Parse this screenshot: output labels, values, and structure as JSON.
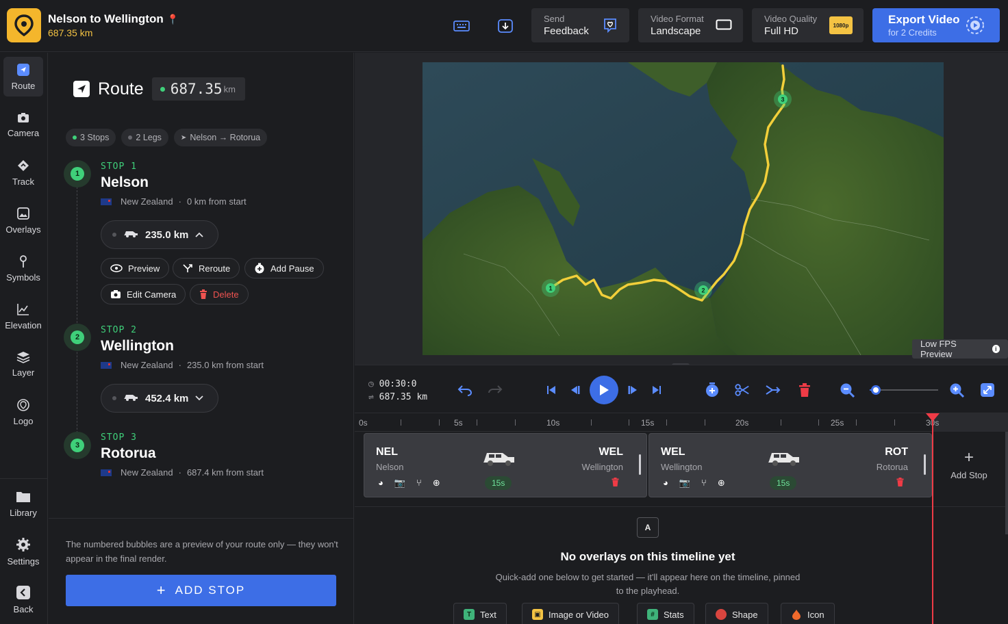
{
  "app": {
    "title": "Nelson to Wellington",
    "distance": "687.35 km"
  },
  "toolbar": {
    "feedback": {
      "line1": "Send",
      "line2": "Feedback"
    },
    "format": {
      "line1": "Video Format",
      "line2": "Landscape"
    },
    "quality": {
      "line1": "Video Quality",
      "line2": "Full HD",
      "badge": "1080p"
    },
    "export": {
      "line1": "Export Video",
      "line2": "for 2 Credits"
    }
  },
  "nav": {
    "items": [
      {
        "label": "Route"
      },
      {
        "label": "Camera"
      },
      {
        "label": "Track"
      },
      {
        "label": "Overlays"
      },
      {
        "label": "Symbols"
      },
      {
        "label": "Elevation"
      },
      {
        "label": "Layer"
      },
      {
        "label": "Logo"
      }
    ],
    "bottom": [
      {
        "label": "Library"
      },
      {
        "label": "Settings"
      },
      {
        "label": "Back"
      }
    ]
  },
  "route": {
    "title": "Route",
    "km_value": "687.35",
    "km_unit": "km",
    "chips": {
      "stops": "3 Stops",
      "legs": "2 Legs",
      "path": "Nelson → Rotorua"
    },
    "stops": [
      {
        "num": "1",
        "label": "STOP 1",
        "name": "Nelson",
        "country": "New Zealand",
        "dist": "0 km from start"
      },
      {
        "num": "2",
        "label": "STOP 2",
        "name": "Wellington",
        "country": "New Zealand",
        "dist": "235.0 km from start"
      },
      {
        "num": "3",
        "label": "STOP 3",
        "name": "Rotorua",
        "country": "New Zealand",
        "dist": "687.4 km from start"
      }
    ],
    "legs": [
      {
        "value": "235.0 km"
      },
      {
        "value": "452.4 km"
      }
    ],
    "actions": {
      "preview": "Preview",
      "reroute": "Reroute",
      "add_pause": "Add Pause",
      "edit_camera": "Edit Camera",
      "delete": "Delete"
    },
    "note": "The numbered bubbles are a preview of your route only — they won't appear in the final render.",
    "add_stop": "ADD STOP"
  },
  "map": {
    "low_fps": "Low FPS Preview",
    "markers": [
      "1",
      "2",
      "3"
    ]
  },
  "transport": {
    "time": "00:30:0",
    "distance": "687.35 km"
  },
  "ruler": {
    "labels": [
      "0s",
      "5s",
      "10s",
      "15s",
      "20s",
      "25s",
      "30s"
    ]
  },
  "clips": [
    {
      "from_code": "NEL",
      "from_city": "Nelson",
      "to_code": "WEL",
      "to_city": "Wellington",
      "duration": "15s"
    },
    {
      "from_code": "WEL",
      "from_city": "Wellington",
      "to_code": "ROT",
      "to_city": "Rotorua",
      "duration": "15s"
    }
  ],
  "timeline": {
    "add_stop": "Add Stop"
  },
  "overlays": {
    "icon_letter": "A",
    "heading": "No overlays on this timeline yet",
    "text": "Quick-add one below to get started — it'll appear here on the timeline, pinned to the playhead.",
    "quick_add": [
      "Text",
      "Image or Video",
      "Stats",
      "Shape",
      "Icon"
    ]
  },
  "colors": {
    "accent": "#3d6ee6",
    "green": "#3fd07a",
    "route_line": "#f2cf3a",
    "danger": "#ef3b46",
    "brand": "#f4b62c"
  }
}
